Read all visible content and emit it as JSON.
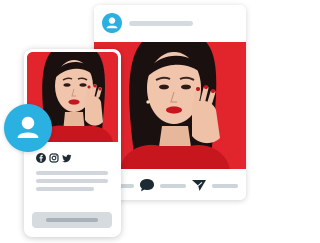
{
  "colors": {
    "accent": "#2bb0e2",
    "photo_background": "#e2252d",
    "placeholder_line": "#d0d6dc",
    "button_fill": "#d6dbe0"
  },
  "back_card": {
    "avatar_icon": "user-icon",
    "photo": "portrait-photo",
    "actions": [
      "chat-bubble-icon",
      "send-icon"
    ]
  },
  "front_card": {
    "photo": "portrait-photo",
    "social_icons": [
      "facebook-icon",
      "instagram-icon",
      "twitter-icon"
    ]
  },
  "profile_avatar_icon": "user-icon"
}
